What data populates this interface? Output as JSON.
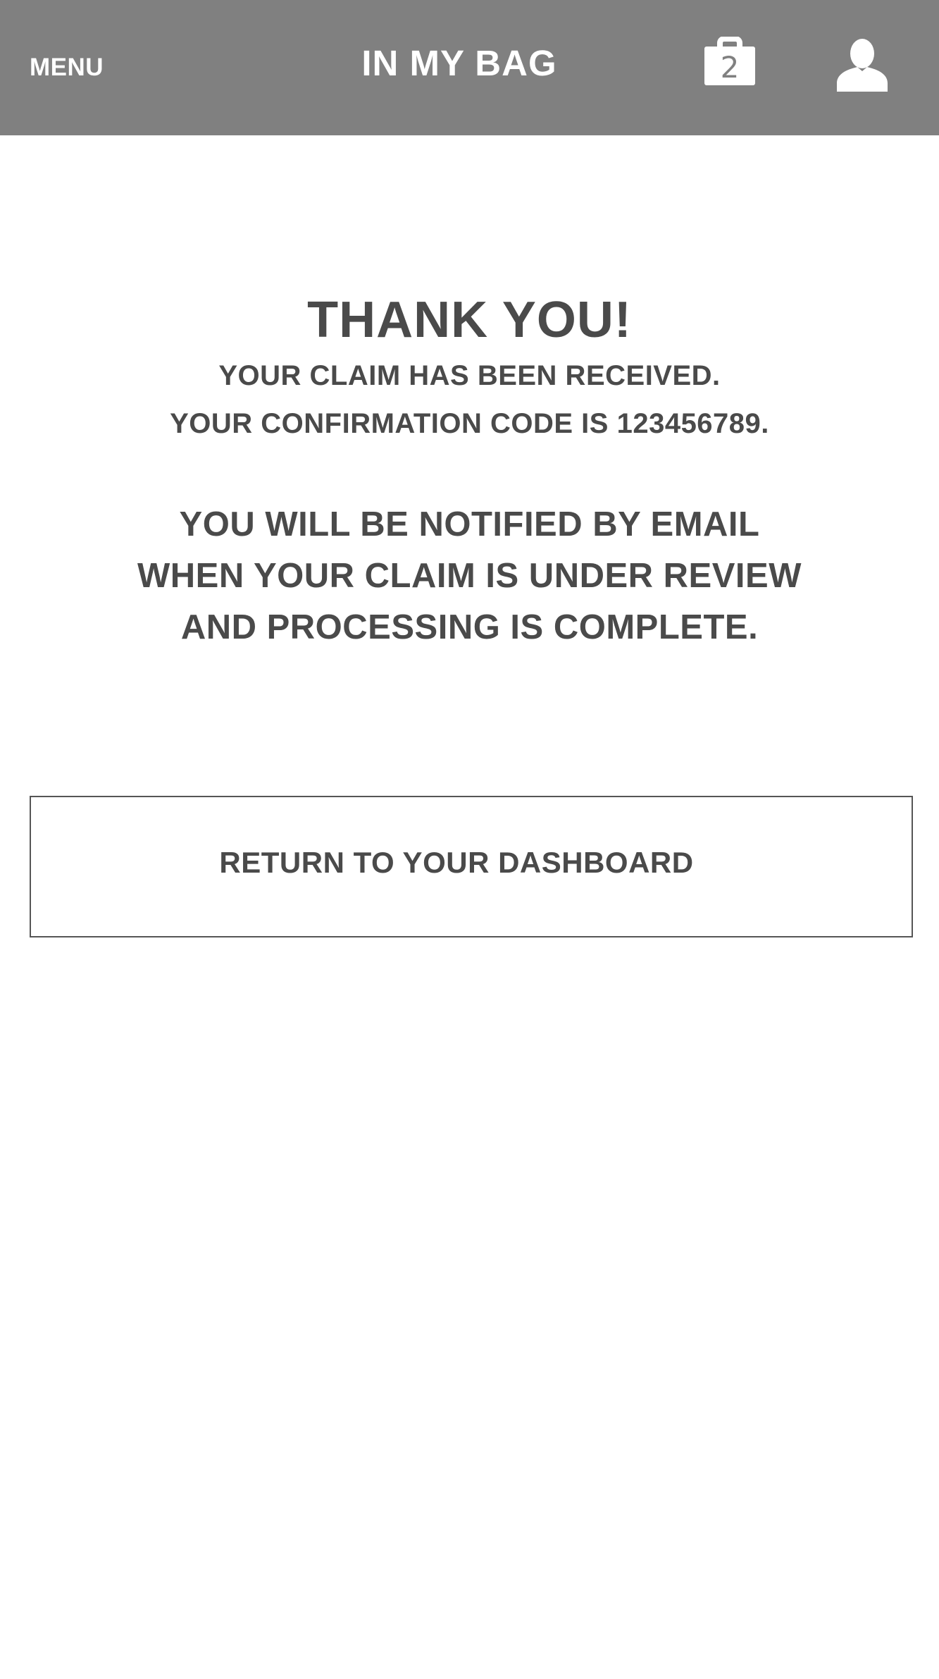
{
  "header": {
    "menu_label": "MENU",
    "title": "IN MY BAG",
    "bag_icon": "bag-icon",
    "bag_count": "2",
    "user_icon": "user-icon",
    "background_color": "#808080"
  },
  "confirmation": {
    "heading": "THANK YOU!",
    "received": "YOUR CLAIM HAS BEEN RECEIVED.",
    "code_line": "YOUR CONFIRMATION CODE IS 123456789.",
    "notice_lines": [
      "YOU WILL BE NOTIFIED BY EMAIL",
      "WHEN YOUR CLAIM IS UNDER REVIEW",
      "AND PROCESSING IS COMPLETE."
    ]
  },
  "actions": {
    "return_label": "RETURN TO YOUR DASHBOARD"
  }
}
